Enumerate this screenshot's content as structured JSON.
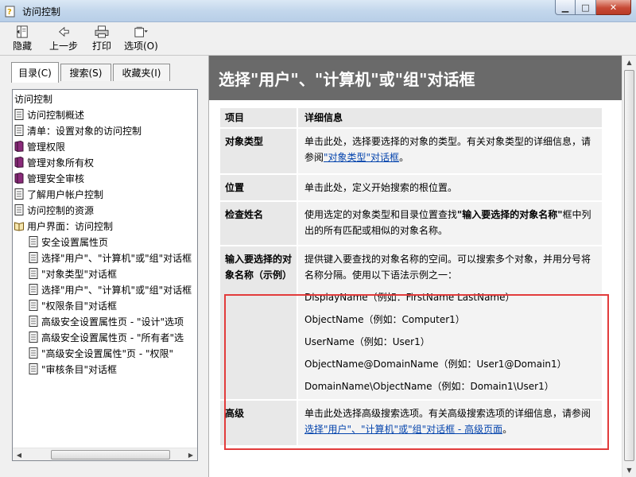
{
  "window": {
    "title": "访问控制"
  },
  "toolbar": {
    "hide": "隐藏",
    "back": "上一步",
    "print": "打印",
    "options": "选项(O)"
  },
  "tabs": [
    "目录(C)",
    "搜索(S)",
    "收藏夹(I)"
  ],
  "tree": [
    {
      "label": "访问控制",
      "icon": "none"
    },
    {
      "label": "访问控制概述",
      "icon": "page-icon"
    },
    {
      "label": "清单：设置对象的访问控制",
      "icon": "page-icon"
    },
    {
      "label": "管理权限",
      "icon": "book-icon"
    },
    {
      "label": "管理对象所有权",
      "icon": "book-icon"
    },
    {
      "label": "管理安全审核",
      "icon": "book-icon"
    },
    {
      "label": "了解用户帐户控制",
      "icon": "page-icon"
    },
    {
      "label": "访问控制的资源",
      "icon": "page-icon"
    },
    {
      "label": "用户界面：访问控制",
      "icon": "open-book-icon"
    },
    {
      "label": "安全设置属性页",
      "icon": "page-icon"
    },
    {
      "label": "选择\"用户\"、\"计算机\"或\"组\"对话框",
      "icon": "page-icon"
    },
    {
      "label": "\"对象类型\"对话框",
      "icon": "page-icon"
    },
    {
      "label": "选择\"用户\"、\"计算机\"或\"组\"对话框",
      "icon": "page-icon"
    },
    {
      "label": "\"权限条目\"对话框",
      "icon": "page-icon"
    },
    {
      "label": "高级安全设置属性页 - \"设计\"选项",
      "icon": "page-icon"
    },
    {
      "label": "高级安全设置属性页 - \"所有者\"选",
      "icon": "page-icon"
    },
    {
      "label": "\"高级安全设置属性\"页 - \"权限\"",
      "icon": "page-icon"
    },
    {
      "label": "\"审核条目\"对话框",
      "icon": "page-icon"
    }
  ],
  "page": {
    "heading": "选择\"用户\"、\"计算机\"或\"组\"对话框",
    "table_header": {
      "col1": "项目",
      "col2": "详细信息"
    },
    "rows": [
      {
        "item": "对象类型",
        "detail": "单击此处，选择要选择的对象的类型。有关对象类型的详细信息，请参阅",
        "link": "\"对象类型\"对话框",
        "after": "。"
      },
      {
        "item": "位置",
        "detail": "单击此处，定义开始搜索的根位置。"
      },
      {
        "item": "检查姓名",
        "detail_pre": "使用选定的对象类型和目录位置查找",
        "detail_bold": "\"输入要选择的对象名称\"",
        "detail_post": "框中列出的所有匹配或相似的对象名称。"
      },
      {
        "item": "输入要选择的对象名称（示例）",
        "intro": "提供键入要查找的对象名称的空间。可以搜索多个对象，并用分号将名称分隔。使用以下语法示例之一：",
        "examples": [
          "DisplayName（例如：FirstName LastName）",
          "ObjectName（例如：Computer1）",
          "UserName（例如：User1）",
          "ObjectName@DomainName（例如：User1@Domain1）",
          "DomainName\\ObjectName（例如：Domain1\\User1）"
        ]
      },
      {
        "item": "高级",
        "detail": "单击此处选择高级搜索选项。有关高级搜索选项的详细信息，请参阅",
        "link": "选择\"用户\"、\"计算机\"或\"组\"对话框 - 高级页面",
        "after": "。"
      }
    ]
  }
}
